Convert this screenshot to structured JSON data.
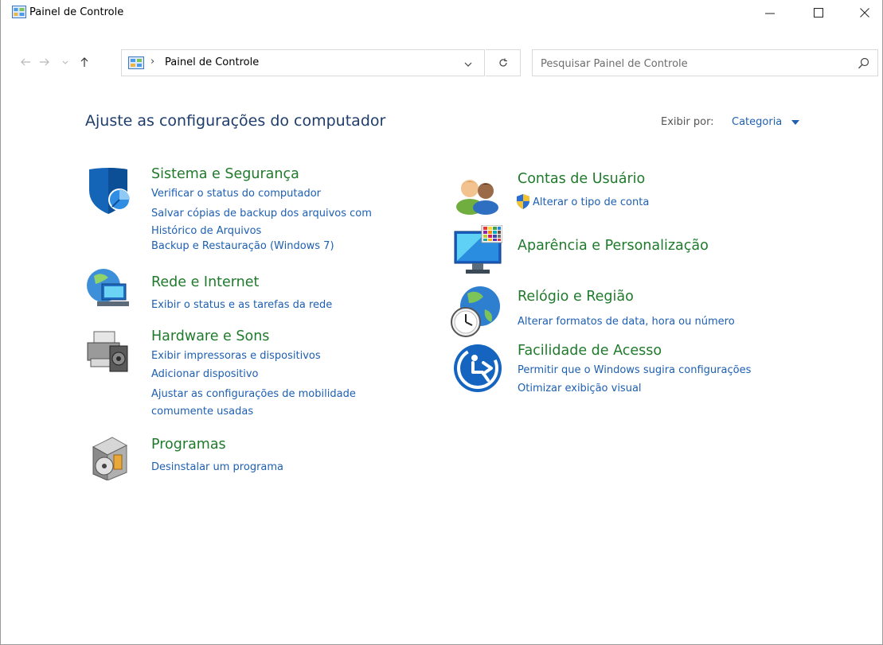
{
  "window": {
    "title": "Painel de Controle"
  },
  "address_bar": {
    "path": "Painel de Controle",
    "separator": "›"
  },
  "search": {
    "placeholder": "Pesquisar Painel de Controle"
  },
  "content": {
    "heading": "Ajuste as configurações do computador",
    "view_by_label": "Exibir por:",
    "view_by_value": "Categoria"
  },
  "categories": {
    "system": {
      "title": "Sistema e Segurança",
      "links": [
        "Verificar o status do computador",
        "Salvar cópias de backup dos arquivos com Histórico de Arquivos",
        "Backup e Restauração (Windows 7)"
      ]
    },
    "network": {
      "title": "Rede e Internet",
      "links": [
        "Exibir o status e as tarefas da rede"
      ]
    },
    "hardware": {
      "title": "Hardware e Sons",
      "links": [
        "Exibir impressoras e dispositivos",
        "Adicionar dispositivo",
        "Ajustar as configurações de mobilidade comumente usadas"
      ]
    },
    "programs": {
      "title": "Programas",
      "links": [
        "Desinstalar um programa"
      ]
    },
    "accounts": {
      "title": "Contas de Usuário",
      "links": [
        "Alterar o tipo de conta"
      ]
    },
    "appearance": {
      "title": "Aparência e Personalização",
      "links": []
    },
    "clock": {
      "title": "Relógio e Região",
      "links": [
        "Alterar formatos de data, hora ou número"
      ]
    },
    "ease": {
      "title": "Facilidade de Acesso",
      "links": [
        "Permitir que o Windows sugira configurações",
        "Otimizar exibição visual"
      ]
    }
  },
  "colors": {
    "category_title": "#1f7a2b",
    "link": "#1d5fb3",
    "heading": "#1e3d6b"
  }
}
